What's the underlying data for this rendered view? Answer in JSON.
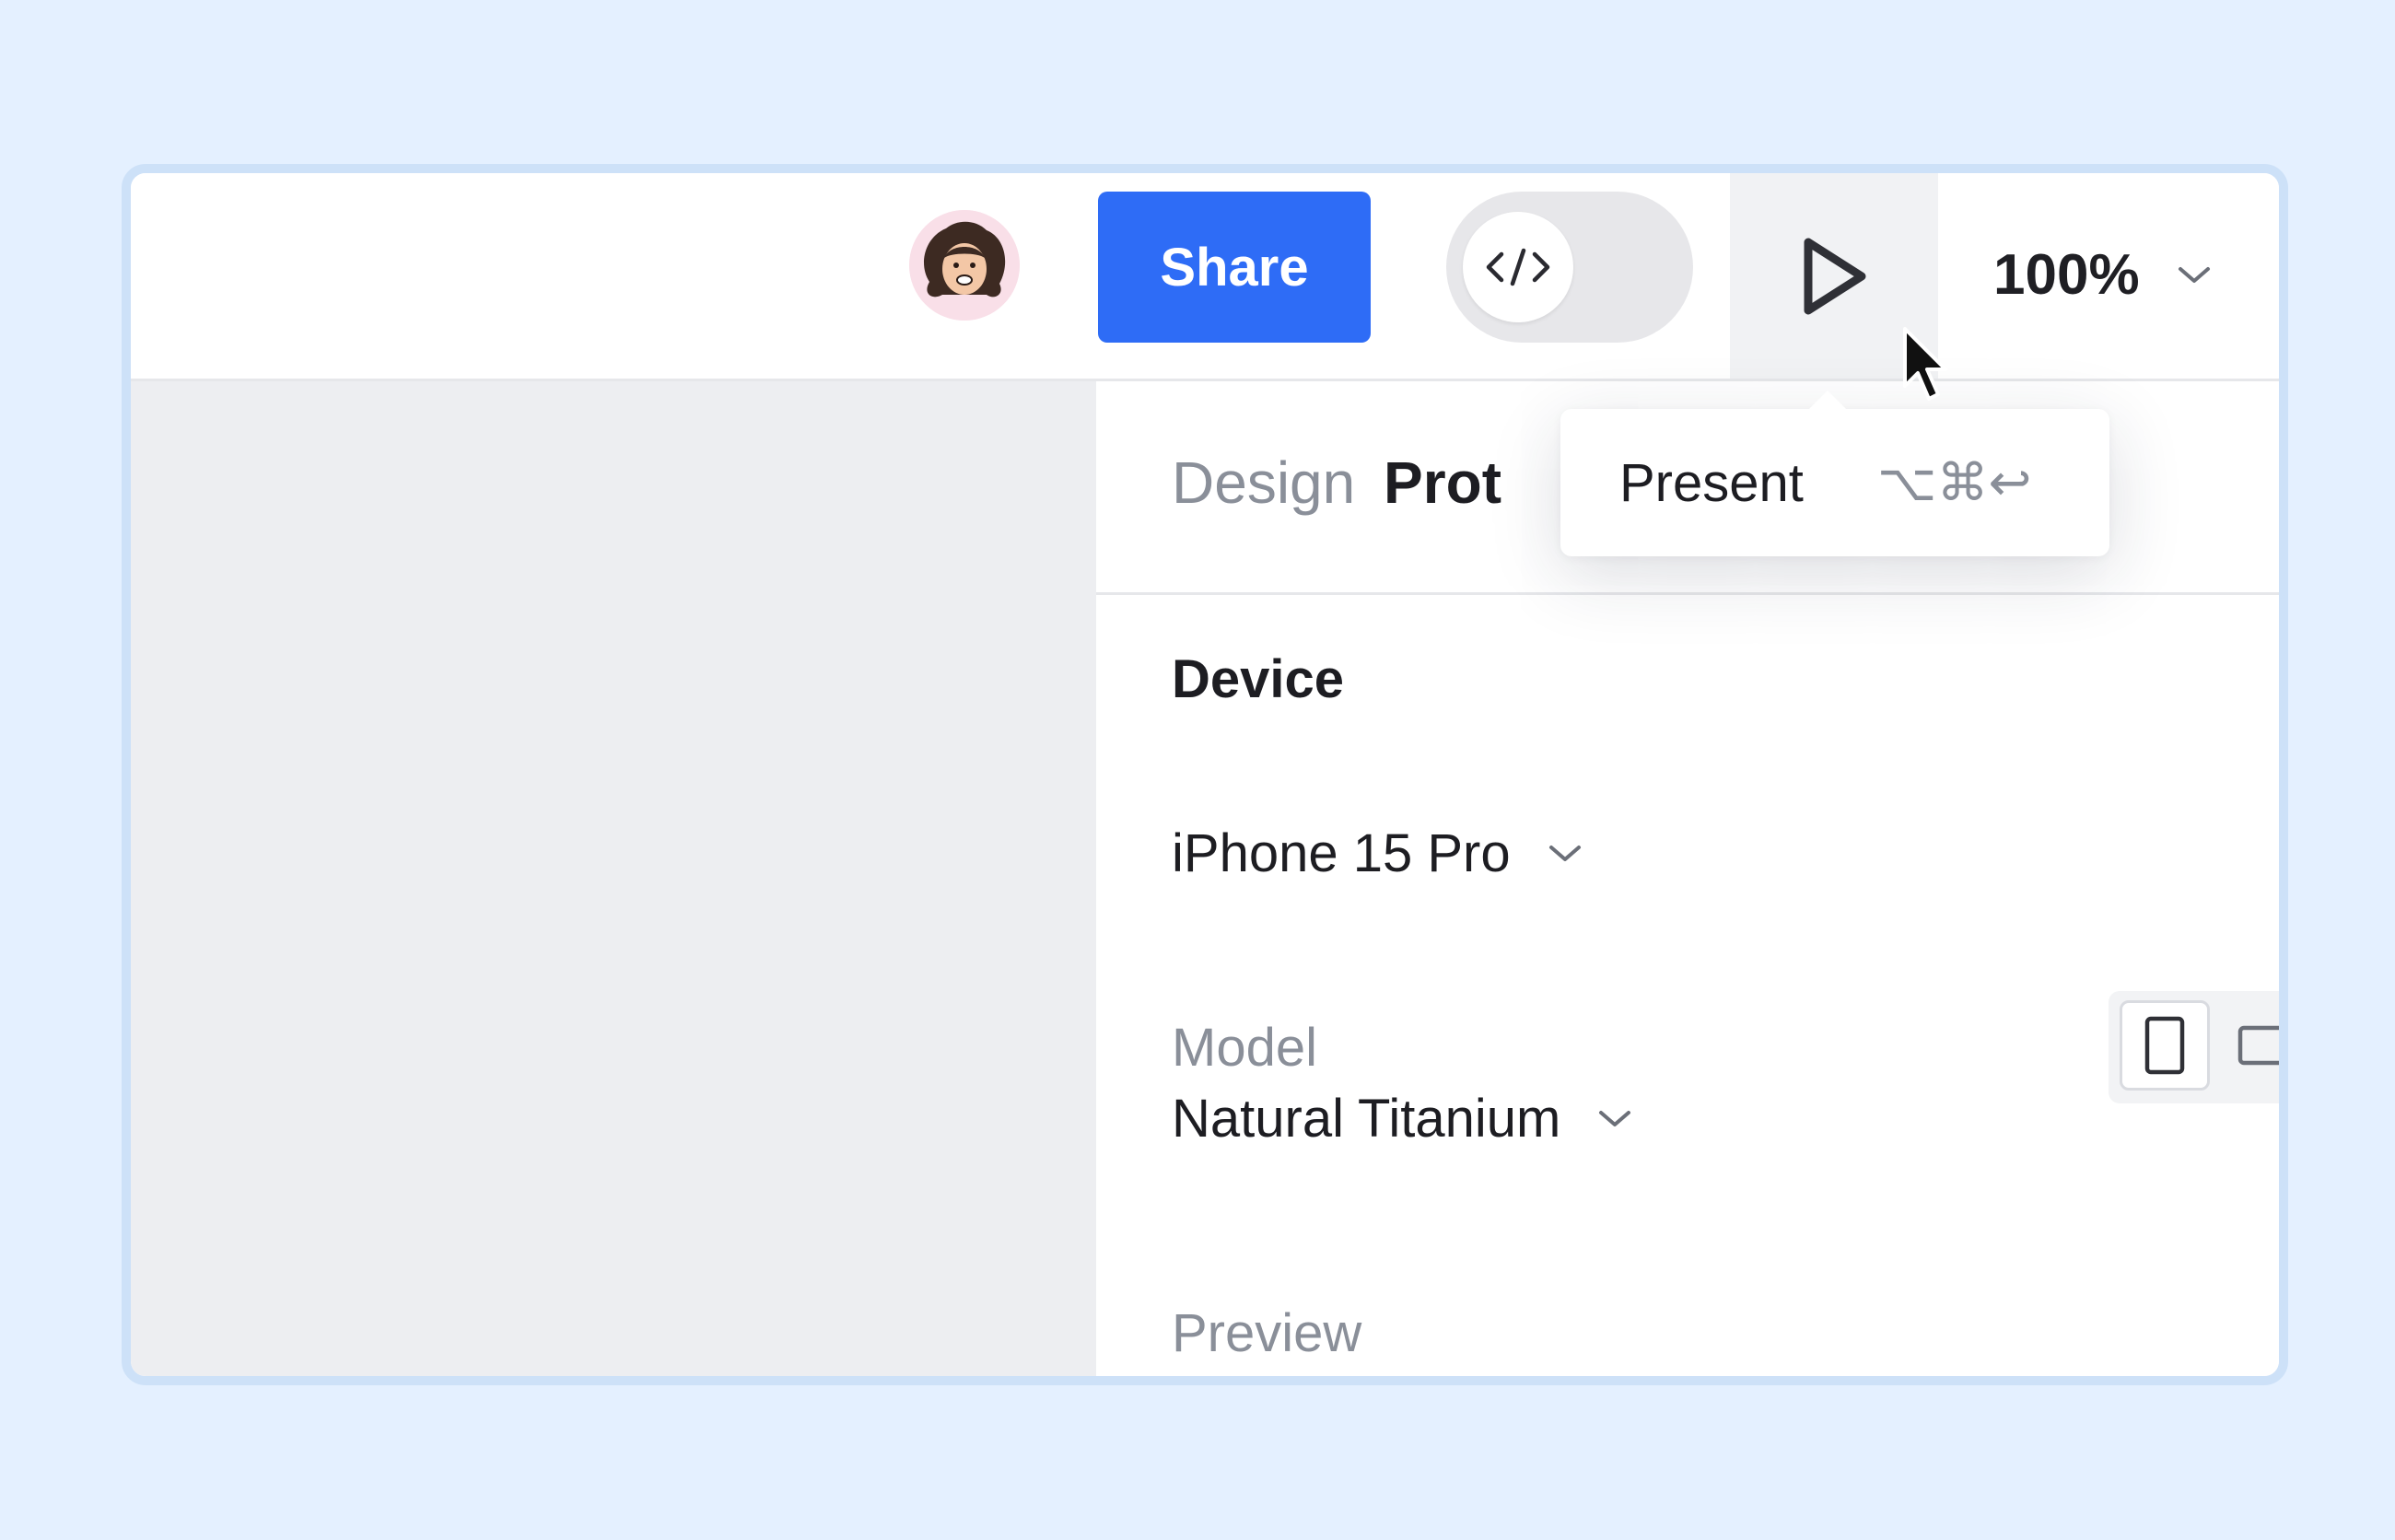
{
  "toolbar": {
    "avatar_alt": "user avatar",
    "share_label": "Share",
    "dev_mode_icon": "code-icon",
    "present_icon": "play-icon",
    "zoom_label": "100%"
  },
  "tooltip": {
    "label": "Present",
    "shortcut": "⌥⌘↩"
  },
  "panel": {
    "tabs": [
      {
        "label": "Design",
        "active": false
      },
      {
        "label": "Prototype",
        "active": true
      }
    ],
    "device_section_title": "Device",
    "device_value": "iPhone 15 Pro",
    "model_label": "Model",
    "model_value": "Natural Titanium",
    "preview_label": "Preview",
    "orientation_selected": "portrait"
  },
  "colors": {
    "background": "#e4f0ff",
    "accent": "#2e6cf6",
    "canvas": "#edeef1"
  }
}
